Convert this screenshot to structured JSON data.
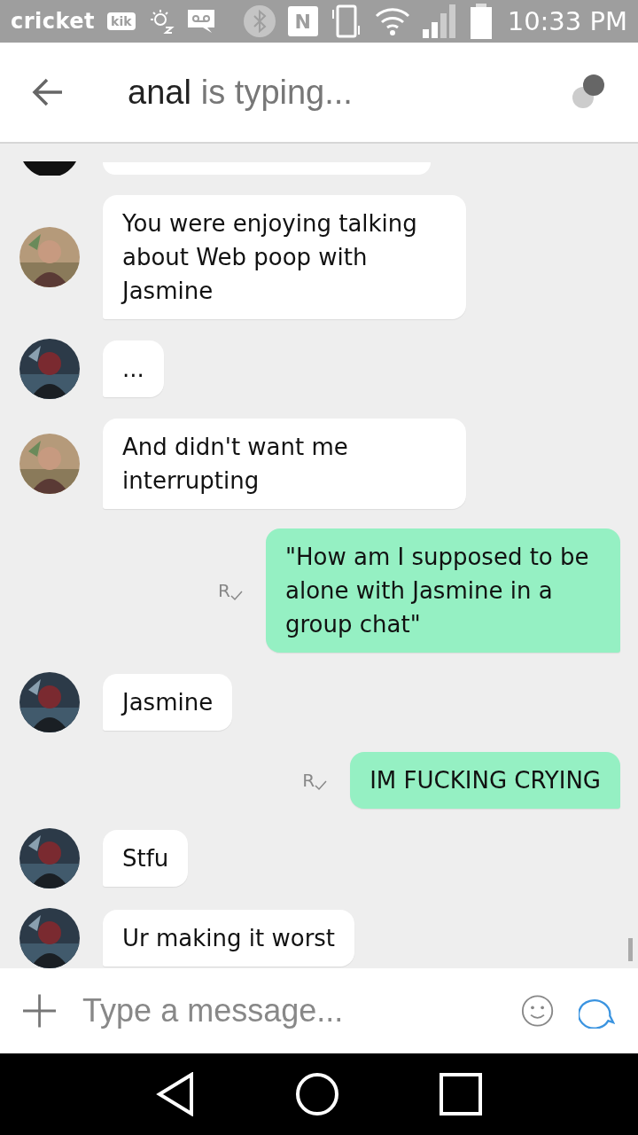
{
  "status_bar": {
    "carrier": "cricket",
    "kik_label": "kik",
    "nfc_label": "N",
    "time": "10:33 PM"
  },
  "header": {
    "name": "anal",
    "status": "is typing..."
  },
  "messages": [
    {
      "kind": "cut",
      "color": "#111111"
    },
    {
      "kind": "incoming",
      "color": "#b59a7a",
      "text": "You were enjoying talking about Web poop with Jasmine"
    },
    {
      "kind": "incoming",
      "color": "#2c3a48",
      "text": "..."
    },
    {
      "kind": "incoming",
      "color": "#b59a7a",
      "text": "And didn't want me interrupting"
    },
    {
      "kind": "outgoing",
      "receipt": "R",
      "text": "\"How am I supposed to be alone with Jasmine in a group chat\""
    },
    {
      "kind": "incoming",
      "color": "#2c3a48",
      "text": "Jasmine"
    },
    {
      "kind": "outgoing",
      "receipt": "R",
      "text": "IM FUCKING CRYING"
    },
    {
      "kind": "incoming",
      "color": "#2c3a48",
      "text": "Stfu"
    },
    {
      "kind": "incoming",
      "color": "#2c3a48",
      "text": "Ur making it worst"
    }
  ],
  "composer": {
    "placeholder": "Type a message..."
  }
}
